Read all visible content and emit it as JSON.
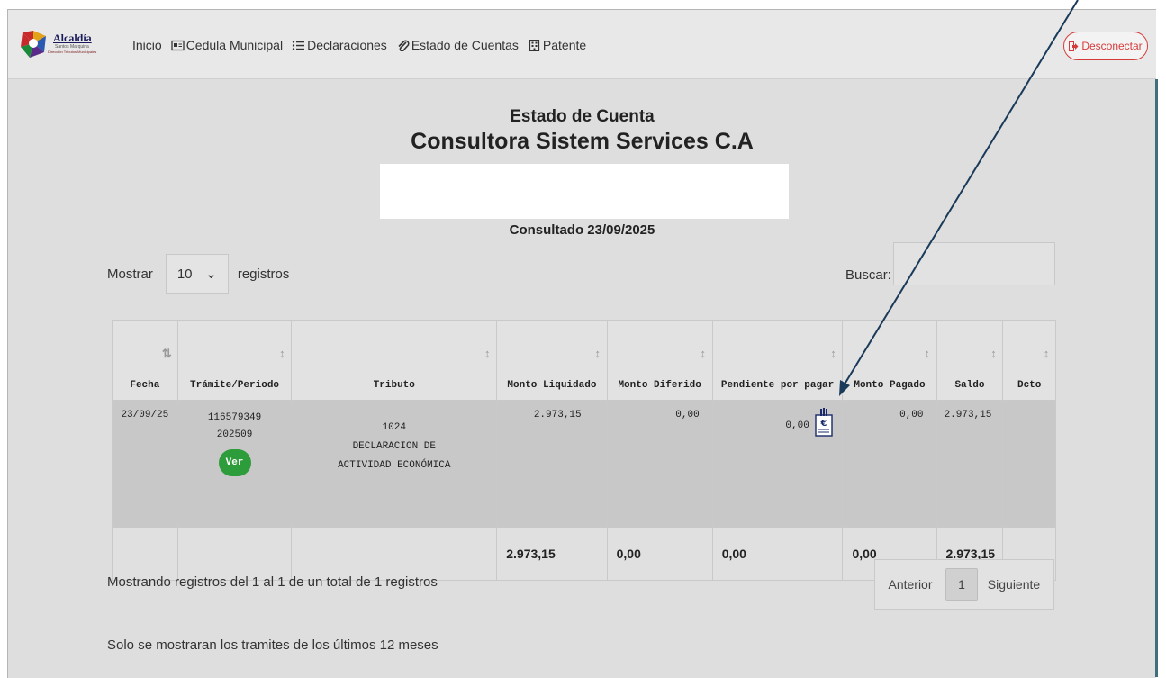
{
  "header": {
    "logo_text": "Alcaldía",
    "logo_sub1": "Santos Marquina",
    "logo_sub2": "Dirección Tributos Municipales",
    "nav": [
      {
        "label": "Inicio"
      },
      {
        "label": "Cedula Municipal",
        "icon": "id-card-icon"
      },
      {
        "label": "Declaraciones",
        "icon": "list-icon"
      },
      {
        "label": "Estado de Cuentas",
        "icon": "paperclip-icon"
      },
      {
        "label": "Patente",
        "icon": "building-icon"
      }
    ],
    "disconnect_label": "Desconectar"
  },
  "page": {
    "title": "Estado de Cuenta",
    "company": "Consultora Sistem Services C.A",
    "consulted": "Consultado 23/09/2025"
  },
  "controls": {
    "show_label": "Mostrar",
    "page_size": "10",
    "records_label": "registros",
    "search_label": "Buscar:",
    "search_value": ""
  },
  "table": {
    "headers": [
      "Fecha",
      "Trámite/Periodo",
      "Tributo",
      "Monto Liquidado",
      "Monto Diferido",
      "Pendiente por pagar",
      "Monto Pagado",
      "Saldo",
      "Dcto"
    ],
    "rows": [
      {
        "fecha": "23/09/25",
        "tramite": "116579349",
        "periodo": "202509",
        "ver_label": "Ver",
        "tributo_code": "1024",
        "tributo_desc": "DECLARACION DE ACTIVIDAD ECONÓMICA",
        "liquidado": "2.973,15",
        "diferido": "0,00",
        "pendiente": "0,00",
        "pagado": "0,00",
        "saldo": "2.973,15"
      }
    ],
    "totals": {
      "liquidado": "2.973,15",
      "diferido": "0,00",
      "pendiente": "0,00",
      "pagado": "0,00",
      "saldo": "2.973,15"
    }
  },
  "footer": {
    "info": "Mostrando registros del 1 al 1 de un total de 1 registros",
    "prev": "Anterior",
    "page": "1",
    "next": "Siguiente",
    "note": "Solo se mostraran los tramites de los últimos 12 meses"
  }
}
